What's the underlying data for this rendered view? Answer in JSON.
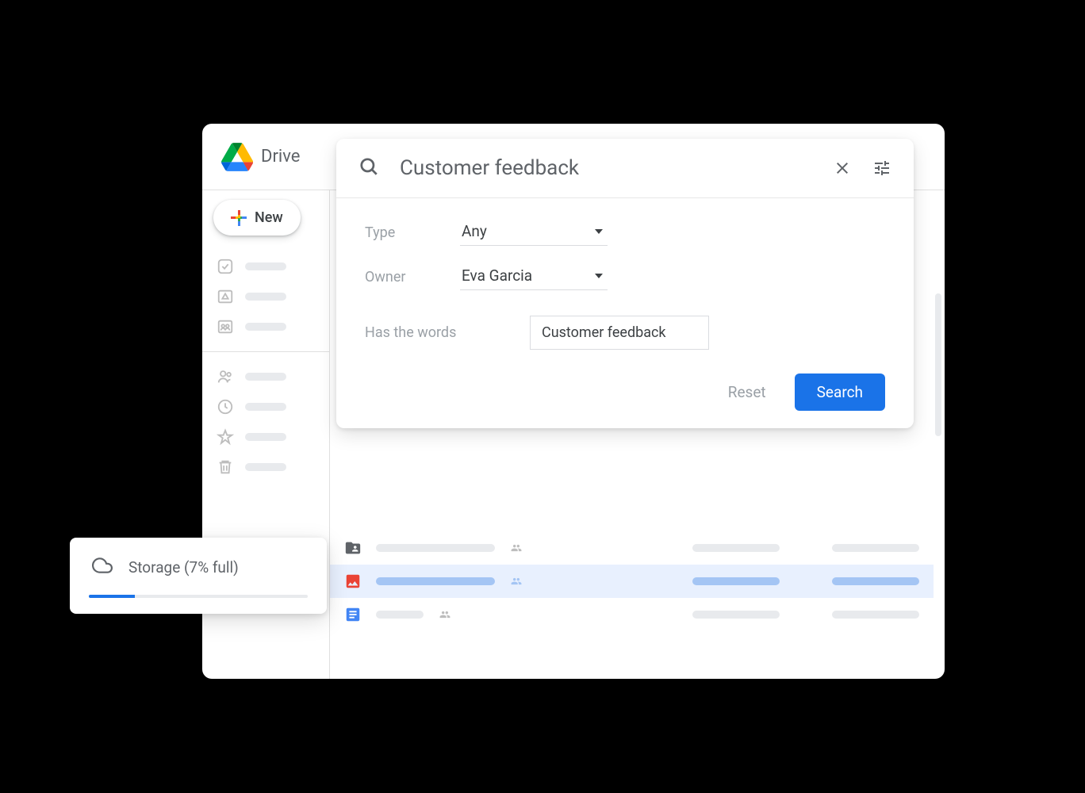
{
  "app": {
    "name": "Drive"
  },
  "sidebar": {
    "new_label": "New"
  },
  "search": {
    "query": "Customer feedback",
    "filters": {
      "type_label": "Type",
      "type_value": "Any",
      "owner_label": "Owner",
      "owner_value": "Eva Garcia",
      "words_label": "Has the words",
      "words_value": "Customer feedback"
    },
    "reset_label": "Reset",
    "search_label": "Search"
  },
  "storage": {
    "label": "Storage (7% full)",
    "percent": 7
  },
  "colors": {
    "accent": "#1a73e8",
    "text_muted": "#5f6368",
    "highlight_bg": "#e8f0fe"
  }
}
